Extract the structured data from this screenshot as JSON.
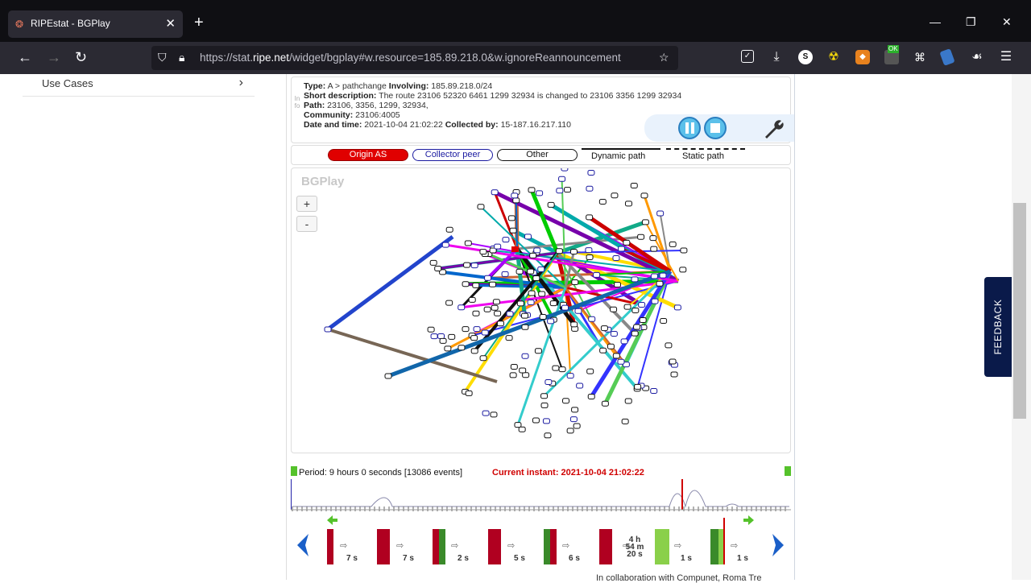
{
  "browser": {
    "tab_title": "RIPEstat - BGPlay",
    "url_prefix": "https://stat.",
    "url_domain": "ripe.net",
    "url_rest": "/widget/bgplay#w.resource=185.89.218.0&w.ignoreReannouncement"
  },
  "sidebar": {
    "use_cases_label": "Use Cases"
  },
  "info": {
    "side_label": "Info",
    "type_label": "Type:",
    "type_value": "A > pathchange",
    "involving_label": "Involving:",
    "involving_value": "185.89.218.0/24",
    "short_label": "Short description:",
    "short_value": "The route 23106 52320 6461 1299 32934 is changed to 23106 3356 1299 32934",
    "path_label": "Path:",
    "path_value": "23106, 3356, 1299, 32934,",
    "community_label": "Community:",
    "community_value": "23106:4005",
    "date_label": "Date and time:",
    "date_value": "2021-10-04 21:02:22",
    "collected_label": "Collected by:",
    "collected_value": "15-187.16.217.110"
  },
  "legend": {
    "origin": "Origin AS",
    "collector": "Collector peer",
    "other": "Other",
    "dynamic": "Dynamic path",
    "static": "Static path"
  },
  "graph": {
    "logo": "BGPlay",
    "zoom_in": "+",
    "zoom_out": "-"
  },
  "timeline": {
    "period": "Period: 9 hours 0 seconds [13086 events]",
    "current": "Current instant: 2021-10-04 21:02:22",
    "steps": [
      "7 s",
      "7 s",
      "2 s",
      "5 s",
      "6 s",
      "4 h 54 m 20 s",
      "1 s",
      "1 s"
    ]
  },
  "feedback_label": "FEEDBACK",
  "footer": "In collaboration with Compunet, Roma Tre",
  "colors": {
    "accent": "#0a1a4a",
    "origin": "#e00000",
    "collector": "#1a1aa0"
  }
}
